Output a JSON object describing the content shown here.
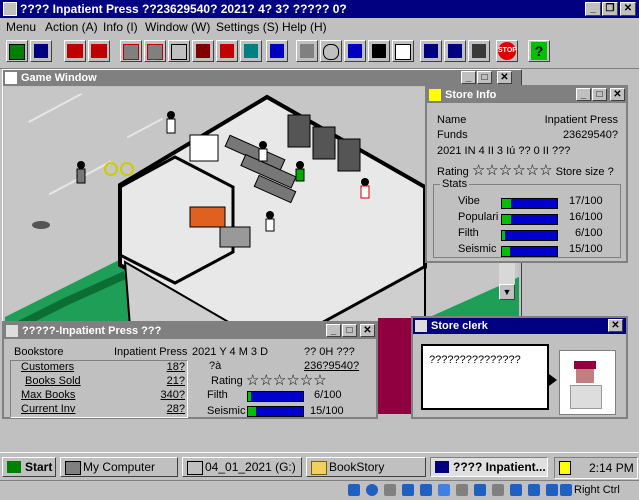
{
  "titlebar": {
    "title": "???? Inpatient Press  ??23629540? 2021? 4? 3? ????? 0?"
  },
  "menu": [
    "Menu",
    "Action (A)",
    "Info (I)",
    "Window (W)",
    "Settings (S)",
    "Help (H)"
  ],
  "toolbar": {
    "icons": [
      "select-icon",
      "save-icon",
      "shelf-in-icon",
      "shelf-out-icon",
      "shelf-add-icon",
      "shelf-remove-icon",
      "register-icon",
      "staff-hire-icon",
      "staff-fire-icon",
      "ad-icon",
      "stock-icon",
      "lamp-icon",
      "search-icon",
      "graph-icon",
      "chart-icon",
      "table-icon",
      "window1-icon",
      "window2-icon",
      "grid-icon",
      "stop-icon",
      "help-icon"
    ],
    "stop_label": "STOP",
    "help_label": "?"
  },
  "game_window": {
    "title": "Game Window"
  },
  "store_info": {
    "title": "Store Info",
    "name_label": "Name",
    "name_value": "Inpatient Press",
    "funds_label": "Funds",
    "funds_value": "23629540?",
    "date": "2021 IN  4 II  3 Iú   ?? 0 II    ???",
    "rating_label": "Rating",
    "rating_stars": "☆☆☆☆☆☆",
    "size_label": "Store size  ?",
    "stats_label": "Stats",
    "stats": [
      {
        "name": "Vibe",
        "value": "17/100",
        "level": 0.17
      },
      {
        "name": "Populari",
        "value": "16/100",
        "level": 0.16
      },
      {
        "name": "Filth",
        "value": "6/100",
        "level": 0.06
      },
      {
        "name": "Seismic",
        "value": "15/100",
        "level": 0.15
      }
    ]
  },
  "summary": {
    "title": "?????-Inpatient Press ???",
    "store_type": "Bookstore",
    "store_name": "Inpatient Press",
    "date": "2021 Y   4 M   3 D",
    "time": "?? 0H      ???",
    "yen": "236?9540?",
    "yen_label": "?à",
    "rows": [
      {
        "label": "Customers",
        "value": "18?"
      },
      {
        "label": "Books Sold",
        "value": "21?"
      },
      {
        "label": "Max Books",
        "value": "340?"
      },
      {
        "label": "Current Inv",
        "value": "28?"
      }
    ],
    "rating_label": "Rating",
    "rating_stars": "☆☆☆☆☆☆",
    "filth_label": "Filth",
    "filth_value": "6/100",
    "filth_level": 0.06,
    "seismic_label": "Seismic",
    "seismic_value": "15/100",
    "seismic_level": 0.15
  },
  "clerk": {
    "title": "Store clerk",
    "message": "???????????????"
  },
  "taskbar": {
    "start": "Start",
    "tasks": [
      "My Computer",
      "04_01_2021 (G:)",
      "BookStory",
      "???? Inpatient..."
    ],
    "clock": "2:14 PM"
  },
  "statusbar": {
    "right_ctrl": "Right Ctrl"
  },
  "colors": {
    "titlebar": "#000080",
    "face": "#c0c0c0",
    "bar_blue": "#0000cc",
    "bar_green": "#00c000",
    "grass": "#1e9e56"
  }
}
